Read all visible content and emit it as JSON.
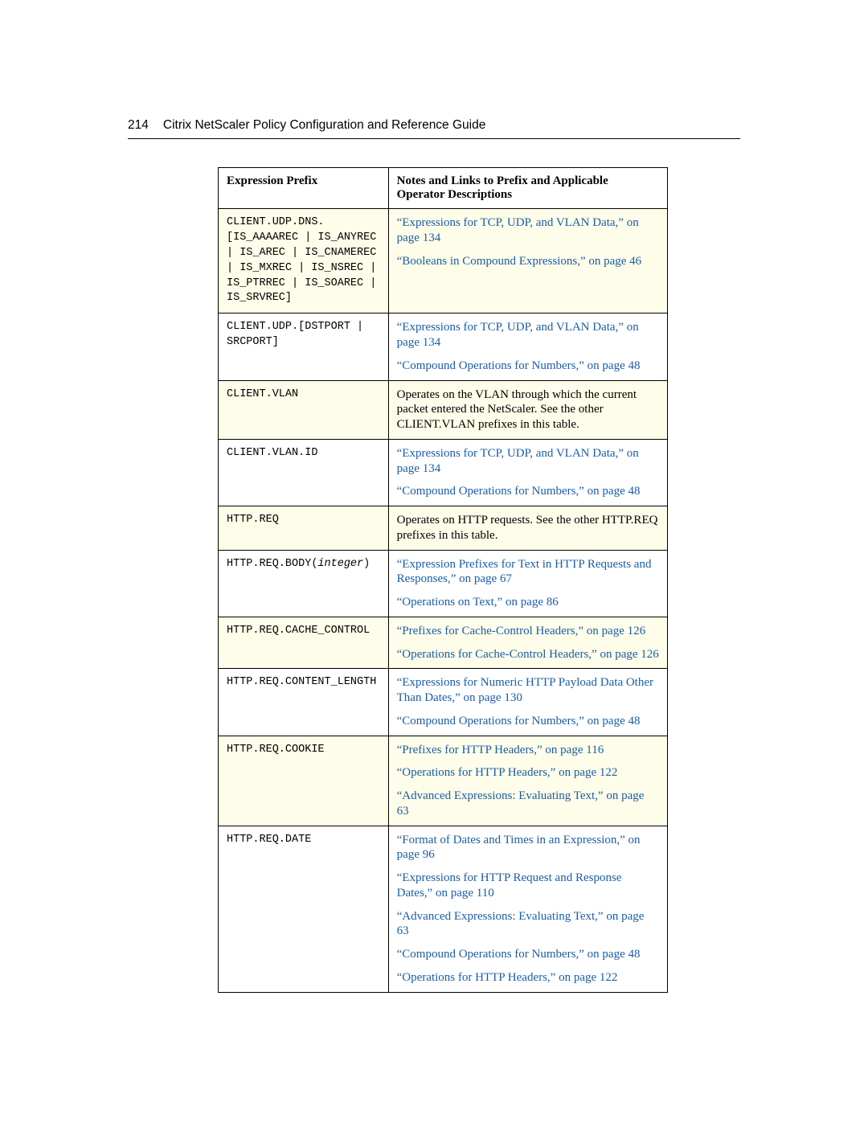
{
  "header": {
    "page_number": "214",
    "title": "Citrix NetScaler Policy Configuration and Reference Guide"
  },
  "table": {
    "headers": {
      "col1": "Expression Prefix",
      "col2": "Notes and Links to Prefix and Applicable Operator Descriptions"
    },
    "rows": [
      {
        "alt": true,
        "prefix": "CLIENT.UDP.DNS.\n[IS_AAAAREC | IS_ANYREC | IS_AREC | IS_CNAMEREC | IS_MXREC | IS_NSREC | IS_PTRREC | IS_SOAREC | IS_SRVREC]",
        "notes": [
          {
            "link": "“Expressions for TCP, UDP, and VLAN Data,” on page 134"
          },
          {
            "link": "“Booleans in Compound Expressions,” on page 46"
          }
        ]
      },
      {
        "alt": false,
        "prefix": "CLIENT.UDP.[DSTPORT | SRCPORT]",
        "notes": [
          {
            "link": "“Expressions for TCP, UDP, and VLAN Data,” on page 134"
          },
          {
            "link": "“Compound Operations for Numbers,” on page 48"
          }
        ]
      },
      {
        "alt": true,
        "prefix": "CLIENT.VLAN",
        "notes": [
          {
            "plain": "Operates on the VLAN through which the current packet entered the NetScaler. See the other CLIENT.VLAN prefixes in this table."
          }
        ]
      },
      {
        "alt": false,
        "prefix": "CLIENT.VLAN.ID",
        "notes": [
          {
            "link": "“Expressions for TCP, UDP, and VLAN Data,” on page 134"
          },
          {
            "link": "“Compound Operations for Numbers,” on page 48"
          }
        ]
      },
      {
        "alt": true,
        "prefix": "HTTP.REQ",
        "notes": [
          {
            "plain": "Operates on HTTP requests. See the other HTTP.REQ prefixes in this table."
          }
        ]
      },
      {
        "alt": false,
        "prefix_html": "HTTP.REQ.BODY(<span class=\"italic\">integer</span>)",
        "notes": [
          {
            "link": "“Expression Prefixes for Text in HTTP Requests and Responses,” on page 67"
          },
          {
            "link": "“Operations on Text,” on page 86"
          }
        ]
      },
      {
        "alt": true,
        "prefix": "HTTP.REQ.CACHE_CONTROL",
        "notes": [
          {
            "link": "“Prefixes for Cache-Control Headers,” on page 126"
          },
          {
            "link": "“Operations for Cache-Control Headers,” on page 126"
          }
        ]
      },
      {
        "alt": false,
        "prefix": "HTTP.REQ.CONTENT_LENGTH",
        "notes": [
          {
            "link": "“Expressions for Numeric HTTP Payload Data Other Than Dates,” on page 130"
          },
          {
            "link": "“Compound Operations for Numbers,” on page 48"
          }
        ]
      },
      {
        "alt": true,
        "prefix": "HTTP.REQ.COOKIE",
        "notes": [
          {
            "link": "“Prefixes for HTTP Headers,” on page 116"
          },
          {
            "link": "“Operations for HTTP Headers,” on page 122"
          },
          {
            "link": "“Advanced Expressions: Evaluating Text,” on page 63"
          }
        ]
      },
      {
        "alt": false,
        "prefix": "HTTP.REQ.DATE",
        "notes": [
          {
            "link": "“Format of Dates and Times in an Expression,” on page 96"
          },
          {
            "link": "“Expressions for HTTP Request and Response Dates,” on page 110"
          },
          {
            "link": "“Advanced Expressions: Evaluating Text,” on page 63"
          },
          {
            "link": "“Compound Operations for Numbers,” on page 48"
          },
          {
            "link": "“Operations for HTTP Headers,” on page 122"
          }
        ]
      }
    ]
  }
}
